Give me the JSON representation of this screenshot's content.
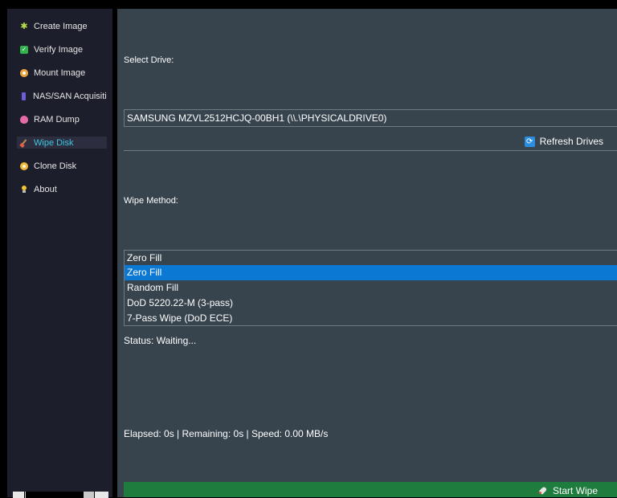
{
  "sidebar": {
    "items": [
      {
        "label": "Create Image",
        "icon": "puzzle-icon",
        "active": false
      },
      {
        "label": "Verify Image",
        "icon": "checkbox-icon",
        "active": false
      },
      {
        "label": "Mount Image",
        "icon": "disc-icon",
        "active": false
      },
      {
        "label": "NAS/SAN Acquisition",
        "icon": "nas-icon",
        "active": false
      },
      {
        "label": "RAM Dump",
        "icon": "brain-icon",
        "active": false
      },
      {
        "label": "Wipe Disk",
        "icon": "broom-icon",
        "active": true
      },
      {
        "label": "Clone Disk",
        "icon": "clone-disc-icon",
        "active": false
      },
      {
        "label": "About",
        "icon": "lightbulb-icon",
        "active": false
      }
    ]
  },
  "main": {
    "select_drive_label": "Select Drive:",
    "drive_combo_value": "SAMSUNG MZVL2512HCJQ-00BH1 (\\\\.\\PHYSICALDRIVE0)",
    "refresh_label": "Refresh Drives",
    "wipe_method_label": "Wipe Method:",
    "wipe_method_value": "Zero Fill",
    "wipe_method_options": [
      "Zero Fill",
      "Random Fill",
      "DoD 5220.22-M (3-pass)",
      "7-Pass Wipe (DoD ECE)"
    ],
    "status_text": "Status: Waiting...",
    "progress_text": "Elapsed: 0s | Remaining: 0s | Speed: 0.00 MB/s",
    "start_label": "Start Wipe"
  },
  "colors": {
    "sidebar_bg": "#1d1e2b",
    "main_bg": "#37444d",
    "accent_active": "#3ec7e0",
    "selection": "#0b78d4",
    "start_button": "#1e7d3e"
  }
}
